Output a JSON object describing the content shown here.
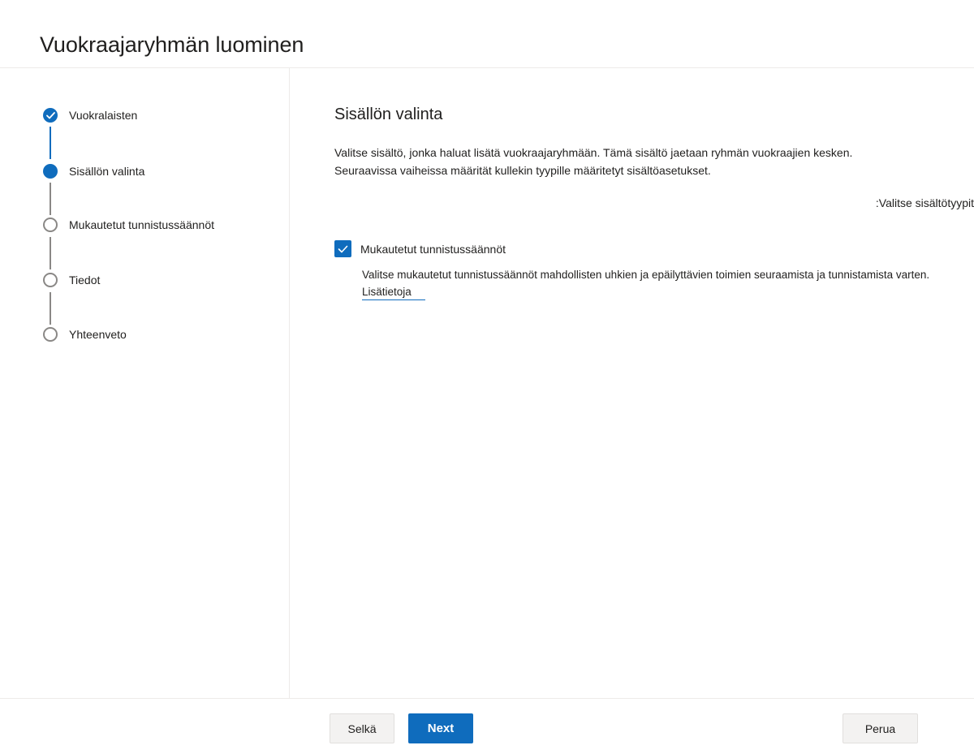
{
  "header": {
    "title": "Vuokraajaryhmän luominen"
  },
  "stepper": {
    "steps": [
      {
        "label": "Vuokralaisten",
        "state": "completed"
      },
      {
        "label": "Sisällön valinta",
        "state": "current"
      },
      {
        "label": "Mukautetut tunnistussäännöt",
        "state": "pending"
      },
      {
        "label": "Tiedot",
        "state": "pending"
      },
      {
        "label": "Yhteenveto",
        "state": "pending"
      }
    ]
  },
  "main": {
    "section_title": "Sisällön valinta",
    "description": "Valitse sisältö, jonka haluat lisätä vuokraajaryhmään. Tämä sisältö jaetaan ryhmän vuokraajien kesken. Seuraavissa vaiheissa määrität kullekin tyypille määritetyt sisältöasetukset.",
    "type_prompt": ":Valitse sisältötyypit",
    "option": {
      "label": "Mukautetut tunnistussäännöt",
      "checked": true,
      "description": "Valitse mukautetut tunnistussäännöt mahdollisten uhkien ja epäilyttävien toimien seuraamista ja tunnistamista varten.",
      "learn_more": "Lisätietoja"
    }
  },
  "footer": {
    "back_label": "Selkä",
    "next_label": "Next",
    "cancel_label": "Perua"
  },
  "colors": {
    "accent": "#0f6cbd",
    "inactive_step": "#8a8886",
    "divider": "#edebe9"
  },
  "icons": {
    "completed_step": "checkmark-icon",
    "checkbox": "checkmark-icon"
  }
}
